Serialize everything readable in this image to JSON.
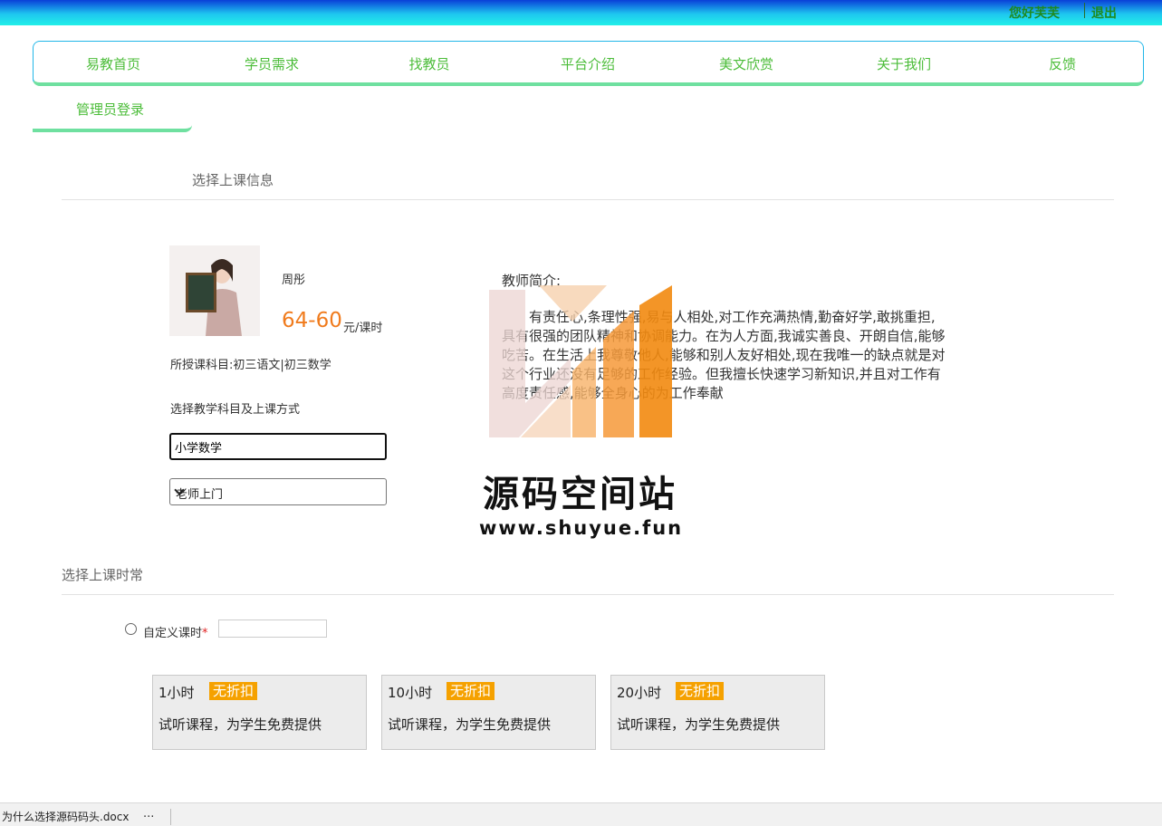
{
  "topbar": {
    "greeting": "您好芙芙",
    "logout": "退出"
  },
  "nav": {
    "items": [
      "易教首页",
      "学员需求",
      "找教员",
      "平台介绍",
      "美文欣赏",
      "关于我们",
      "反馈"
    ],
    "admin_login": "管理员登录"
  },
  "section1": {
    "title": "选择上课信息"
  },
  "teacher": {
    "name": "周彤",
    "price": "64-60",
    "unit": "元/课时",
    "subjects": "所授课科目:初三语文|初三数学",
    "choose_label": "选择教学科目及上课方式",
    "subject_value": "小学数学",
    "mode_selected": "老师上门",
    "intro_label": "教师简介:",
    "intro_text": "有责任心,条理性强,易与人相处,对工作充满热情,勤奋好学,敢挑重担,具有很强的团队精神和协调能力。在为人方面,我诚实善良、开朗自信,能够吃苦。在生活上我尊敬他人,能够和别人友好相处,现在我唯一的缺点就是对这个行业还没有足够的工作经验。但我擅长快速学习新知识,并且对工作有高度责任感,能够全身心的为工作奉献"
  },
  "watermark": {
    "title": "源码空间站",
    "url": "www.shuyue.fun"
  },
  "section2": {
    "title": "选择上课时常",
    "custom_label": "自定义课时",
    "required_mark": "*"
  },
  "packages": [
    {
      "hours": "1小时",
      "badge": "无折扣",
      "desc": "试听课程，为学生免费提供"
    },
    {
      "hours": "10小时",
      "badge": "无折扣",
      "desc": "试听课程，为学生免费提供"
    },
    {
      "hours": "20小时",
      "badge": "无折扣",
      "desc": "试听课程，为学生免费提供"
    }
  ],
  "statusbar": {
    "download_file": "为什么选择源码码头.docx",
    "more": "..."
  },
  "colors": {
    "accent_green": "#4cbd3a",
    "price_orange": "#f07b1d",
    "badge_orange": "#f5a100"
  }
}
